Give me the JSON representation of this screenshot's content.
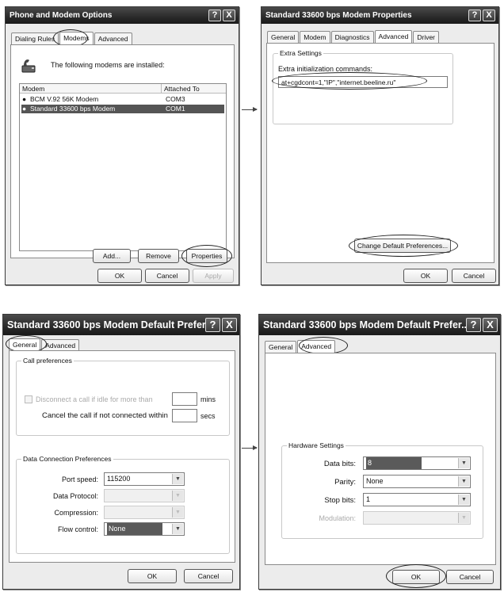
{
  "win1": {
    "title": "Phone and Modem Options",
    "help_glyph": "?",
    "close_glyph": "X",
    "tabs": [
      "Dialing Rules",
      "Modems",
      "Advanced"
    ],
    "intro": "The following modems are installed:",
    "columns": [
      "Modem",
      "Attached To"
    ],
    "rows": [
      {
        "modem": "BCM V.92 56K Modem",
        "port": "COM3"
      },
      {
        "modem": "Standard 33600 bps Modem",
        "port": "COM1"
      }
    ],
    "add_label": "Add...",
    "remove_label": "Remove",
    "properties_label": "Properties",
    "ok_label": "OK",
    "cancel_label": "Cancel",
    "apply_label": "Apply"
  },
  "win2": {
    "title": "Standard 33600 bps Modem Properties",
    "help_glyph": "?",
    "close_glyph": "X",
    "tabs": [
      "General",
      "Modem",
      "Diagnostics",
      "Advanced",
      "Driver"
    ],
    "group_label": "Extra Settings",
    "field_label": "Extra initialization commands:",
    "field_value": "at+cgdcont=1,\"IP\",\"internet.beeline.ru\"",
    "change_prefs_label": "Change Default Preferences...",
    "ok_label": "OK",
    "cancel_label": "Cancel"
  },
  "win3": {
    "title": "Standard 33600 bps Modem Default Prefer...",
    "help_glyph": "?",
    "close_glyph": "X",
    "tabs": [
      "General",
      "Advanced"
    ],
    "call_group": "Call preferences",
    "disconnect_label": "Disconnect a call if idle for more than",
    "mins_label": "mins",
    "cancel_call_label": "Cancel the call if not connected within",
    "secs_label": "secs",
    "data_group": "Data Connection Preferences",
    "port_speed_label": "Port speed:",
    "port_speed_value": "115200",
    "data_protocol_label": "Data Protocol:",
    "compression_label": "Compression:",
    "flow_control_label": "Flow control:",
    "flow_control_value": "None",
    "ok_label": "OK",
    "cancel_label": "Cancel"
  },
  "win4": {
    "title": "Standard 33600 bps Modem Default Prefer...",
    "help_glyph": "?",
    "close_glyph": "X",
    "tabs": [
      "General",
      "Advanced"
    ],
    "hw_group": "Hardware Settings",
    "data_bits_label": "Data bits:",
    "data_bits_value": "8",
    "parity_label": "Parity:",
    "parity_value": "None",
    "stop_bits_label": "Stop bits:",
    "stop_bits_value": "1",
    "modulation_label": "Modulation:",
    "ok_label": "OK",
    "cancel_label": "Cancel"
  },
  "glyphs": {
    "dropdown": "▼"
  }
}
